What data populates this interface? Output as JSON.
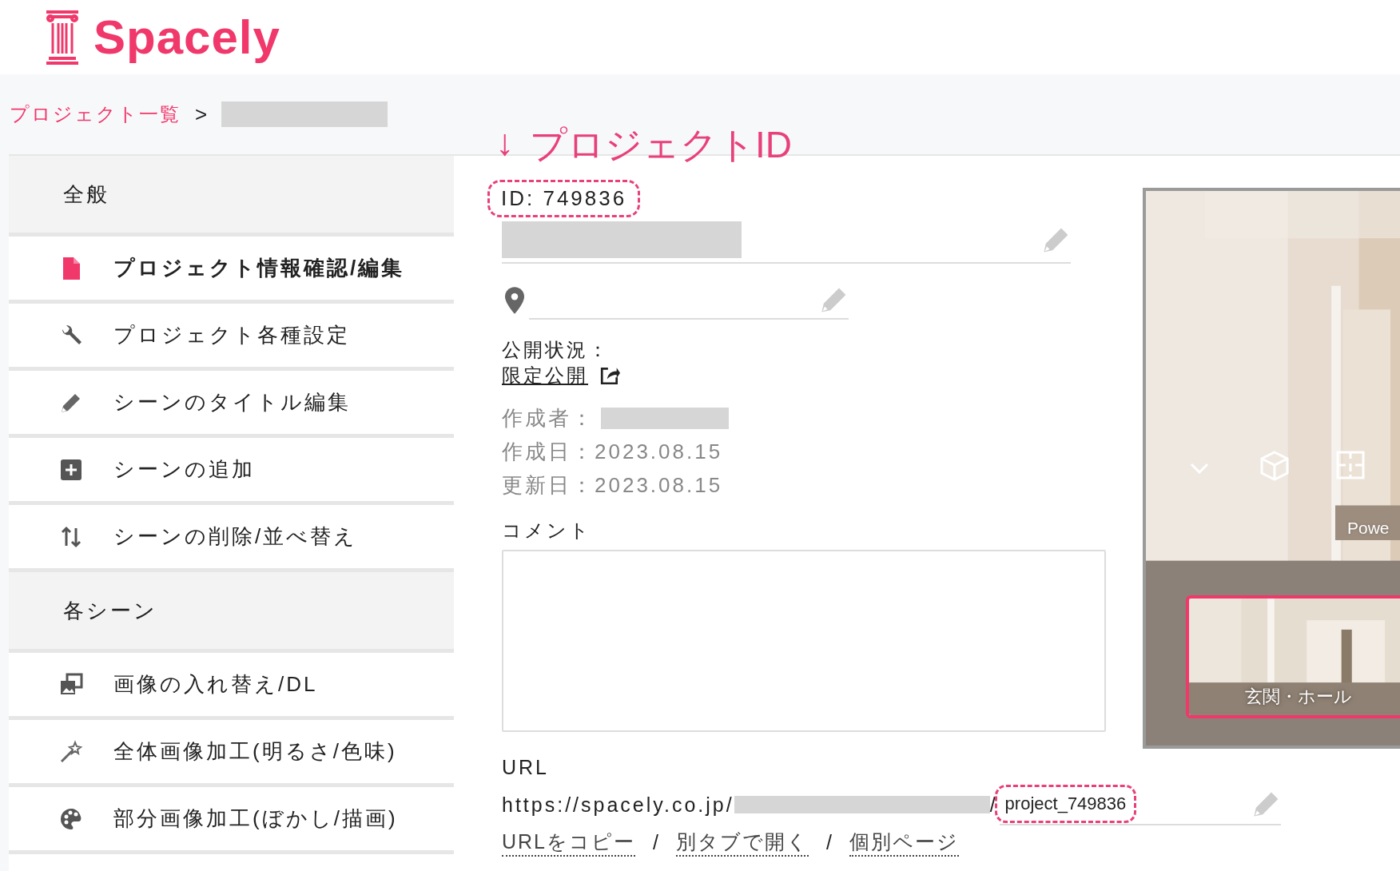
{
  "logo": {
    "text": "Spacely"
  },
  "breadcrumb": {
    "items": [
      {
        "label": "プロジェクト一覧"
      }
    ],
    "separator": ">"
  },
  "annotation": {
    "arrow": "↓",
    "label": "プロジェクトID"
  },
  "sidebar": {
    "sections": [
      {
        "title": "全般",
        "items": [
          {
            "label": "プロジェクト情報確認/編集",
            "kind": "file",
            "selected": true
          },
          {
            "label": "プロジェクト各種設定",
            "kind": "wrench",
            "selected": false
          },
          {
            "label": "シーンのタイトル編集",
            "kind": "pencil",
            "selected": false
          },
          {
            "label": "シーンの追加",
            "kind": "plus",
            "selected": false
          },
          {
            "label": "シーンの削除/並べ替え",
            "kind": "sort",
            "selected": false
          }
        ]
      },
      {
        "title": "各シーン",
        "items": [
          {
            "label": "画像の入れ替え/DL",
            "kind": "images",
            "selected": false
          },
          {
            "label": "全体画像加工(明るさ/色味)",
            "kind": "wand",
            "selected": false
          },
          {
            "label": "部分画像加工(ぼかし/描画)",
            "kind": "palette",
            "selected": false
          }
        ]
      }
    ]
  },
  "project": {
    "id": "ID: 749836",
    "status_label": "公開状況：",
    "status_link": "限定公開",
    "creator_label": "作成者：",
    "created": "作成日：2023.08.15",
    "updated": "更新日：2023.08.15",
    "comment_label": "コメント",
    "url_label": "URL",
    "url_prefix": "https://spacely.co.jp/",
    "url_separator": "/",
    "url_slug": "project_749836",
    "url_actions": [
      "URLをコピー",
      "別タブで開く",
      "個別ページ"
    ],
    "action_separator": "/"
  },
  "viewer": {
    "overlay_text": "Powe",
    "scenes": [
      {
        "label": "玄関・ホール",
        "selected": true
      }
    ]
  }
}
